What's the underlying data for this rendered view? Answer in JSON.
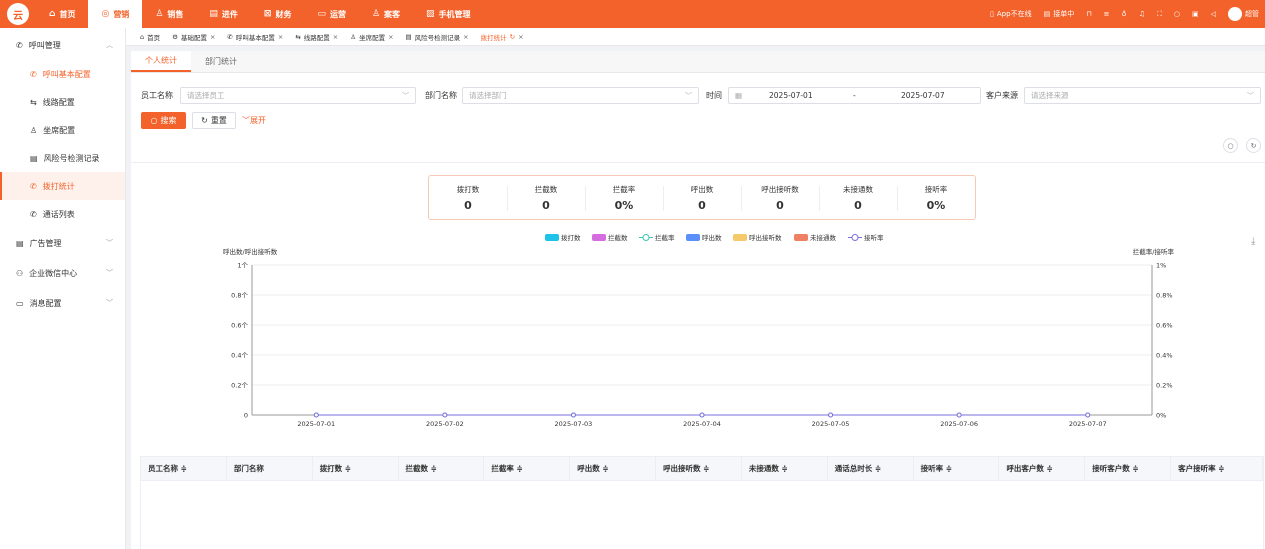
{
  "brand": {
    "logo_text": "云"
  },
  "nav": [
    {
      "label": "首页",
      "icon": "home-icon"
    },
    {
      "label": "营销",
      "icon": "target-icon",
      "active": true
    },
    {
      "label": "销售",
      "icon": "user-icon"
    },
    {
      "label": "进件",
      "icon": "document-icon"
    },
    {
      "label": "财务",
      "icon": "finance-icon"
    },
    {
      "label": "运营",
      "icon": "monitor-icon"
    },
    {
      "label": "案客",
      "icon": "person-icon"
    },
    {
      "label": "手机管理",
      "icon": "image-icon"
    }
  ],
  "topright": {
    "app_status": "App不在线",
    "dispatch": "接单中",
    "username": "超管"
  },
  "sidebar": {
    "groups": [
      {
        "label": "呼叫管理",
        "expanded": true,
        "items": [
          {
            "label": "呼叫基本配置",
            "active": true
          },
          {
            "label": "线路配置"
          },
          {
            "label": "坐席配置"
          },
          {
            "label": "风险号检测记录"
          },
          {
            "label": "拨打统计",
            "selected": true
          },
          {
            "label": "通话列表"
          }
        ]
      },
      {
        "label": "广告管理"
      },
      {
        "label": "企业微信中心"
      },
      {
        "label": "消息配置"
      }
    ]
  },
  "tabs": [
    {
      "label": "首页"
    },
    {
      "label": "基础配置"
    },
    {
      "label": "呼叫基本配置"
    },
    {
      "label": "线路配置"
    },
    {
      "label": "坐席配置"
    },
    {
      "label": "风险号检测记录"
    },
    {
      "label": "拨打统计",
      "active": true
    }
  ],
  "subtabs": [
    "个人统计",
    "部门统计"
  ],
  "filters": {
    "employee_label": "员工名称",
    "employee_placeholder": "请选择员工",
    "dept_label": "部门名称",
    "dept_placeholder": "请选择部门",
    "time_label": "时间",
    "date_start": "2025-07-01",
    "date_sep": "-",
    "date_end": "2025-07-07",
    "source_label": "客户来源",
    "source_placeholder": "请选择来源",
    "search_btn": "搜索",
    "reset_btn": "重置",
    "expand_btn": "展开"
  },
  "stats": [
    {
      "label": "拨打数",
      "value": "0"
    },
    {
      "label": "拦截数",
      "value": "0"
    },
    {
      "label": "拦截率",
      "value": "0%"
    },
    {
      "label": "呼出数",
      "value": "0"
    },
    {
      "label": "呼出接听数",
      "value": "0"
    },
    {
      "label": "未接通数",
      "value": "0"
    },
    {
      "label": "接听率",
      "value": "0%"
    }
  ],
  "chart_data": {
    "type": "bar",
    "categories": [
      "2025-07-01",
      "2025-07-02",
      "2025-07-03",
      "2025-07-04",
      "2025-07-05",
      "2025-07-06",
      "2025-07-07"
    ],
    "series": [
      {
        "name": "拨打数",
        "kind": "bar",
        "color": "#1fc3e8",
        "values": [
          0,
          0,
          0,
          0,
          0,
          0,
          0
        ]
      },
      {
        "name": "拦截数",
        "kind": "bar",
        "color": "#d56ce0",
        "values": [
          0,
          0,
          0,
          0,
          0,
          0,
          0
        ]
      },
      {
        "name": "拦截率",
        "kind": "line",
        "color": "#3bc6b4",
        "values": [
          0,
          0,
          0,
          0,
          0,
          0,
          0
        ]
      },
      {
        "name": "呼出数",
        "kind": "bar",
        "color": "#5b8ff9",
        "values": [
          0,
          0,
          0,
          0,
          0,
          0,
          0
        ]
      },
      {
        "name": "呼出接听数",
        "kind": "bar",
        "color": "#f6c96b",
        "values": [
          0,
          0,
          0,
          0,
          0,
          0,
          0
        ]
      },
      {
        "name": "未接通数",
        "kind": "bar",
        "color": "#f08063",
        "values": [
          0,
          0,
          0,
          0,
          0,
          0,
          0
        ]
      },
      {
        "name": "接听率",
        "kind": "line",
        "color": "#7b6fe0",
        "values": [
          0,
          0,
          0,
          0,
          0,
          0,
          0
        ]
      }
    ],
    "ylabel_left": "呼出数/呼出接听数",
    "ylabel_right": "拦截率/接听率",
    "yticks_left": [
      "0",
      "0.2个",
      "0.4个",
      "0.6个",
      "0.8个",
      "1个"
    ],
    "yticks_right": [
      "0%",
      "0.2%",
      "0.4%",
      "0.6%",
      "0.8%",
      "1%"
    ],
    "ylim_left": [
      0,
      1
    ],
    "ylim_right": [
      0,
      1
    ],
    "grid": true,
    "legend": "top-center"
  },
  "table": {
    "columns": [
      "员工名称 ≑",
      "部门名称",
      "拨打数 ≑",
      "拦截数 ≑",
      "拦截率 ≑",
      "呼出数 ≑",
      "呼出接听数 ≑",
      "未接通数 ≑",
      "通话总时长 ≑",
      "接听率 ≑",
      "呼出客户数 ≑",
      "接听客户数 ≑",
      "客户接听率 ≑"
    ]
  }
}
